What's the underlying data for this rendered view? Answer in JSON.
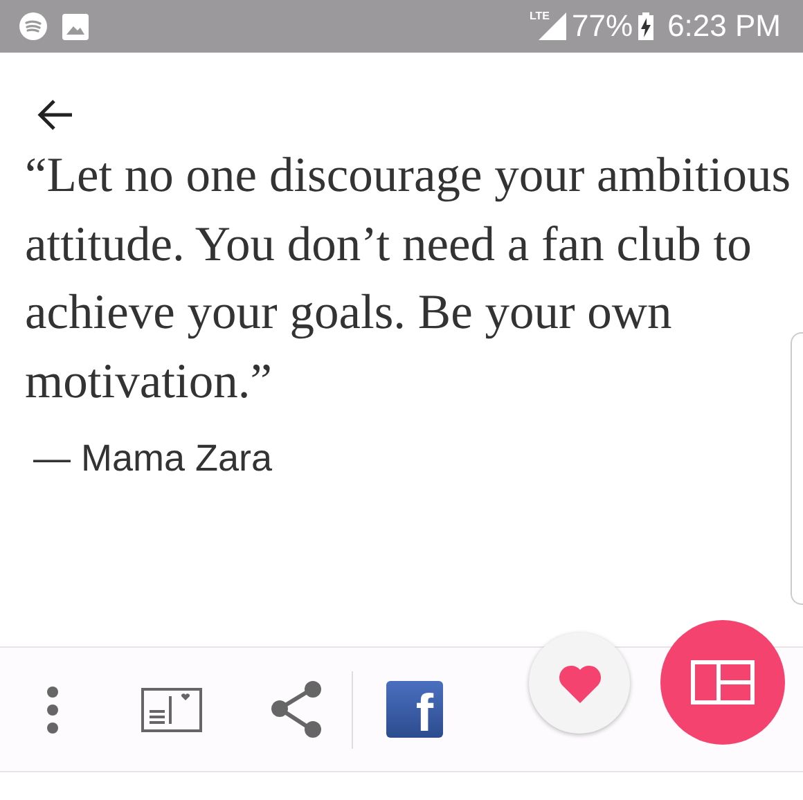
{
  "status_bar": {
    "network": "LTE",
    "battery": "77%",
    "time": "6:23 PM"
  },
  "quote": {
    "text": "“Let no one discourage your ambitious attitude. You don’t need a fan club to achieve your goals. Be your own motivation.”",
    "author": "— Mama Zara"
  },
  "toolbar": {
    "facebook_logo": "f"
  }
}
